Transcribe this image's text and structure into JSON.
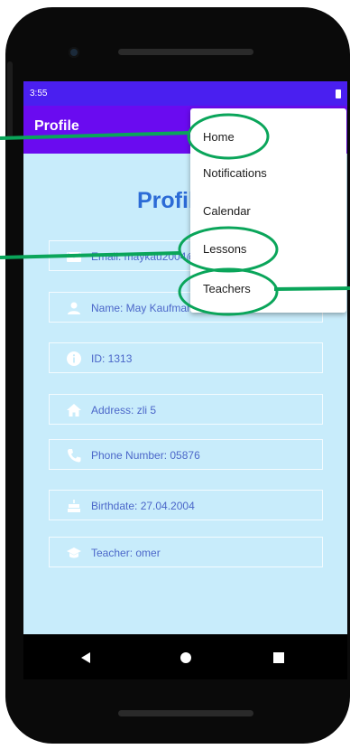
{
  "status_bar": {
    "time": "3:55"
  },
  "app_bar": {
    "title": "Profile"
  },
  "profile": {
    "heading": "Profile",
    "fields": [
      {
        "icon": "email-icon",
        "text": "Email: maykau2004@gmail.com"
      },
      {
        "icon": "person-icon",
        "text": "Name: May Kaufman"
      },
      {
        "icon": "info-icon",
        "text": "ID: 1313"
      },
      {
        "icon": "home-icon",
        "text": "Address: zli 5"
      },
      {
        "icon": "phone-icon",
        "text": "Phone Number: 05876"
      },
      {
        "icon": "cake-icon",
        "text": "Birthdate: 27.04.2004"
      },
      {
        "icon": "school-icon",
        "text": "Teacher: omer"
      }
    ]
  },
  "menu": {
    "items": [
      {
        "label": "Home"
      },
      {
        "label": "Notifications"
      },
      {
        "label": "Calendar"
      },
      {
        "label": "Lessons"
      },
      {
        "label": "Teachers"
      }
    ]
  },
  "colors": {
    "status_bar": "#4a1ff0",
    "app_bar": "#6a0bf0",
    "screen_background": "#c8ecfb",
    "heading": "#2c6bd6",
    "field_text": "#4b67c9",
    "annotation": "#0aa55a"
  }
}
